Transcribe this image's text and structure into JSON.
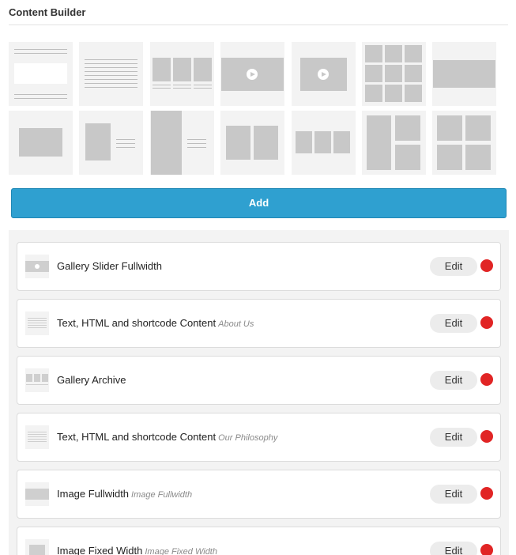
{
  "builder": {
    "title": "Content Builder",
    "add_label": "Add"
  },
  "layout_tiles": [
    {
      "name": "text-html-layout"
    },
    {
      "name": "text-content-layout"
    },
    {
      "name": "gallery-archive-layout"
    },
    {
      "name": "gallery-slider-fullwidth-layout"
    },
    {
      "name": "gallery-slider-fixed-layout"
    },
    {
      "name": "gallery-grid-layout"
    },
    {
      "name": "image-fullwidth-layout"
    },
    {
      "name": "image-fixed-width-layout"
    },
    {
      "name": "image-text-layout"
    },
    {
      "name": "tall-image-text-layout"
    },
    {
      "name": "two-columns-images-layout"
    },
    {
      "name": "three-columns-images-layout"
    },
    {
      "name": "mosaic-images-layout"
    },
    {
      "name": "four-images-grid-layout"
    }
  ],
  "items": [
    {
      "title": "Gallery Slider Fullwidth",
      "subtitle": "",
      "edit_label": "Edit",
      "icon": "gallery-slider-icon"
    },
    {
      "title": "Text, HTML and shortcode Content",
      "subtitle": "About Us",
      "edit_label": "Edit",
      "icon": "text-content-icon"
    },
    {
      "title": "Gallery Archive",
      "subtitle": "",
      "edit_label": "Edit",
      "icon": "gallery-archive-icon"
    },
    {
      "title": "Text, HTML and shortcode Content",
      "subtitle": "Our Philosophy",
      "edit_label": "Edit",
      "icon": "text-content-icon"
    },
    {
      "title": "Image Fullwidth",
      "subtitle": "Image Fullwidth",
      "edit_label": "Edit",
      "icon": "image-fullwidth-icon"
    },
    {
      "title": "Image Fixed Width",
      "subtitle": "Image Fixed Width",
      "edit_label": "Edit",
      "icon": "image-fixed-icon"
    }
  ],
  "colors": {
    "accent": "#2fa0d0",
    "remove_dot": "#e12525",
    "placeholder_gray": "#c8c8c8"
  }
}
